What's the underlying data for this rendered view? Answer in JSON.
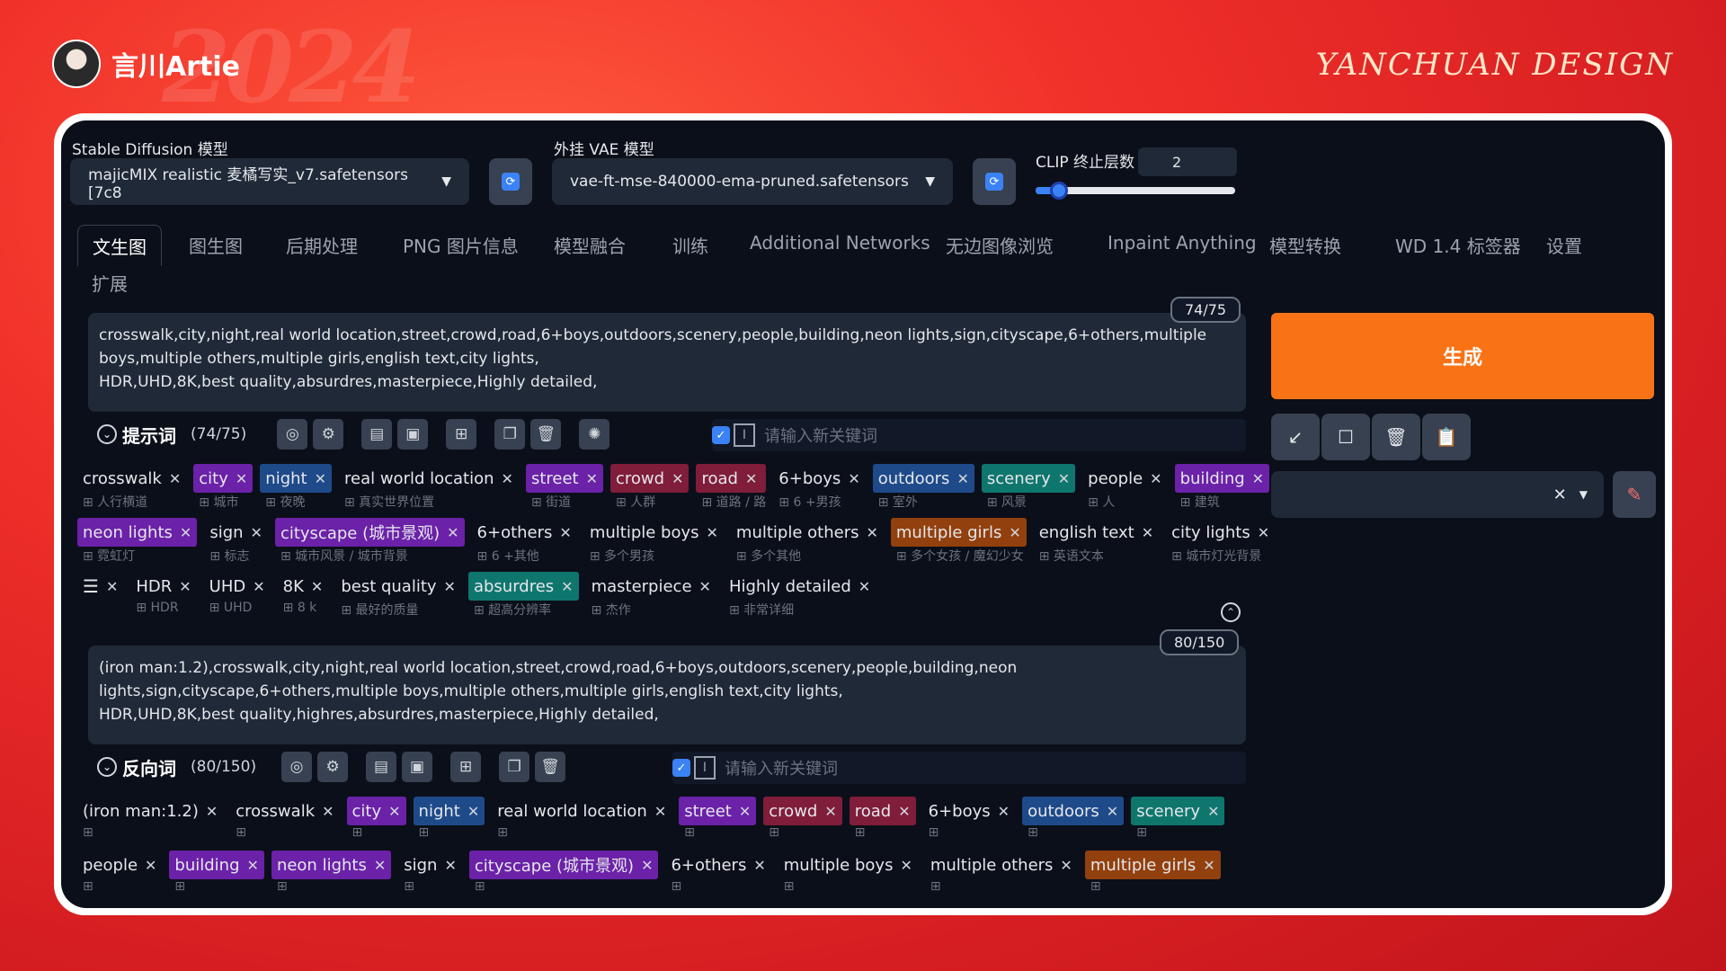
{
  "brand": {
    "name": "言川Artie",
    "logo": "YANCHUAN DESIGN"
  },
  "models": {
    "sd_label": "Stable Diffusion 模型",
    "sd_value": "majicMIX realistic 麦橘写实_v7.safetensors [7c8",
    "vae_label": "外挂 VAE 模型",
    "vae_value": "vae-ft-mse-840000-ema-pruned.safetensors",
    "clip_label": "CLIP 终止层数",
    "clip_value": "2",
    "clip_slider_fraction": 0.1
  },
  "tabs": [
    "文生图",
    "图生图",
    "后期处理",
    "PNG 图片信息",
    "模型融合",
    "训练",
    "Additional Networks",
    "无边图像浏览",
    "Inpaint Anything",
    "模型转换",
    "WD 1.4 标签器",
    "设置",
    "扩展"
  ],
  "prompt": {
    "counter": "74/75",
    "text": "crosswalk,city,night,real world location,street,crowd,road,6+boys,outdoors,scenery,people,building,neon lights,sign,cityscape,6+others,multiple boys,multiple others,multiple girls,english text,city lights,\nHDR,UHD,8K,best quality,absurdres,masterpiece,Highly detailed,",
    "section_title": "提示词",
    "section_count": "(74/75)",
    "keyword_placeholder": "请输入新关键词",
    "rows": [
      [
        {
          "t": "crosswalk",
          "tr": "人行横道",
          "c": "none"
        },
        {
          "t": "city",
          "tr": "城市",
          "c": "purple"
        },
        {
          "t": "night",
          "tr": "夜晚",
          "c": "blue"
        },
        {
          "t": "real world location",
          "tr": "真实世界位置",
          "c": "none"
        },
        {
          "t": "street",
          "tr": "街道",
          "c": "purple"
        },
        {
          "t": "crowd",
          "tr": "人群",
          "c": "maroon"
        },
        {
          "t": "road",
          "tr": "道路 / 路",
          "c": "maroon"
        },
        {
          "t": "6+boys",
          "tr": "6 +男孩",
          "c": "none"
        },
        {
          "t": "outdoors",
          "tr": "室外",
          "c": "blue"
        },
        {
          "t": "scenery",
          "tr": "风景",
          "c": "teal"
        },
        {
          "t": "people",
          "tr": "人",
          "c": "none"
        },
        {
          "t": "building",
          "tr": "建筑",
          "c": "purple"
        }
      ],
      [
        {
          "t": "neon lights",
          "tr": "霓虹灯",
          "c": "purple"
        },
        {
          "t": "sign",
          "tr": "标志",
          "c": "none"
        },
        {
          "t": "cityscape (城市景观)",
          "tr": "城市风景 / 城市背景",
          "c": "purple"
        },
        {
          "t": "6+others",
          "tr": "6 +其他",
          "c": "none"
        },
        {
          "t": "multiple boys",
          "tr": "多个男孩",
          "c": "none"
        },
        {
          "t": "multiple others",
          "tr": "多个其他",
          "c": "none"
        },
        {
          "t": "multiple girls",
          "tr": "多个女孩 / 魔幻少女",
          "c": "orange"
        },
        {
          "t": "english text",
          "tr": "英语文本",
          "c": "none"
        },
        {
          "t": "city lights",
          "tr": "城市灯光背景",
          "c": "none"
        }
      ],
      [
        {
          "t": "HDR",
          "tr": "HDR",
          "c": "none"
        },
        {
          "t": "UHD",
          "tr": "UHD",
          "c": "none"
        },
        {
          "t": "8K",
          "tr": "8 k",
          "c": "none"
        },
        {
          "t": "best quality",
          "tr": "最好的质量",
          "c": "none"
        },
        {
          "t": "absurdres",
          "tr": "超高分辨率",
          "c": "teal"
        },
        {
          "t": "masterpiece",
          "tr": "杰作",
          "c": "none"
        },
        {
          "t": "Highly detailed",
          "tr": "非常详细",
          "c": "none"
        }
      ]
    ]
  },
  "negative": {
    "counter": "80/150",
    "text": "(iron man:1.2),crosswalk,city,night,real world location,street,crowd,road,6+boys,outdoors,scenery,people,building,neon lights,sign,cityscape,6+others,multiple boys,multiple others,multiple girls,english text,city lights,\nHDR,UHD,8K,best quality,highres,absurdres,masterpiece,Highly detailed,",
    "section_title": "反向词",
    "section_count": "(80/150)",
    "keyword_placeholder": "请输入新关键词",
    "rows": [
      [
        {
          "t": "(iron man:1.2)",
          "tr": "",
          "c": "none"
        },
        {
          "t": "crosswalk",
          "tr": "",
          "c": "none"
        },
        {
          "t": "city",
          "tr": "",
          "c": "purple"
        },
        {
          "t": "night",
          "tr": "",
          "c": "blue"
        },
        {
          "t": "real world location",
          "tr": "",
          "c": "none"
        },
        {
          "t": "street",
          "tr": "",
          "c": "purple"
        },
        {
          "t": "crowd",
          "tr": "",
          "c": "maroon"
        },
        {
          "t": "road",
          "tr": "",
          "c": "maroon"
        },
        {
          "t": "6+boys",
          "tr": "",
          "c": "none"
        },
        {
          "t": "outdoors",
          "tr": "",
          "c": "blue"
        },
        {
          "t": "scenery",
          "tr": "",
          "c": "teal"
        }
      ],
      [
        {
          "t": "people",
          "tr": "",
          "c": "none"
        },
        {
          "t": "building",
          "tr": "",
          "c": "purple"
        },
        {
          "t": "neon lights",
          "tr": "",
          "c": "purple"
        },
        {
          "t": "sign",
          "tr": "",
          "c": "none"
        },
        {
          "t": "cityscape (城市景观)",
          "tr": "",
          "c": "purple"
        },
        {
          "t": "6+others",
          "tr": "",
          "c": "none"
        },
        {
          "t": "multiple boys",
          "tr": "",
          "c": "none"
        },
        {
          "t": "multiple others",
          "tr": "",
          "c": "none"
        },
        {
          "t": "multiple girls",
          "tr": "",
          "c": "orange"
        }
      ]
    ]
  },
  "generate": {
    "label": "生成"
  },
  "colors": {
    "accent": "#f97316",
    "bg": "#0b0f19",
    "panel": "#1f2937"
  }
}
